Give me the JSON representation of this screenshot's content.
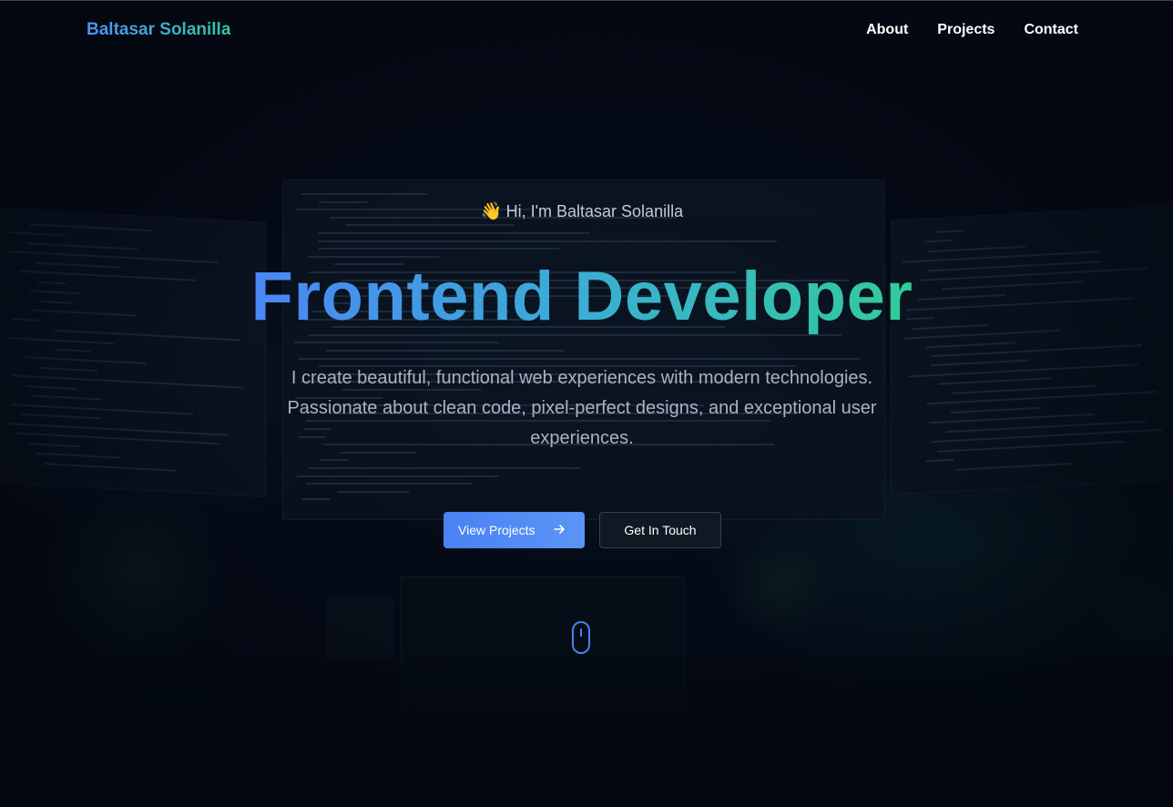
{
  "nav": {
    "logo": "Baltasar Solanilla",
    "links": [
      "About",
      "Projects",
      "Contact"
    ]
  },
  "hero": {
    "wave_icon": "waving-hand-icon",
    "greeting": "Hi, I'm Baltasar Solanilla",
    "title": "Frontend Developer",
    "subtitle": "I create beautiful, functional web experiences with modern technologies. Passionate about clean code, pixel-perfect designs, and exceptional user experiences.",
    "primary_button": "View Projects",
    "primary_button_icon": "arrow-right-icon",
    "secondary_button": "Get In Touch",
    "scroll_icon": "mouse-scroll-icon"
  },
  "colors": {
    "background": "#040a16",
    "accent_blue": "#4a86f5",
    "accent_green": "#32cb9a",
    "text_muted": "#a9b3c1"
  }
}
